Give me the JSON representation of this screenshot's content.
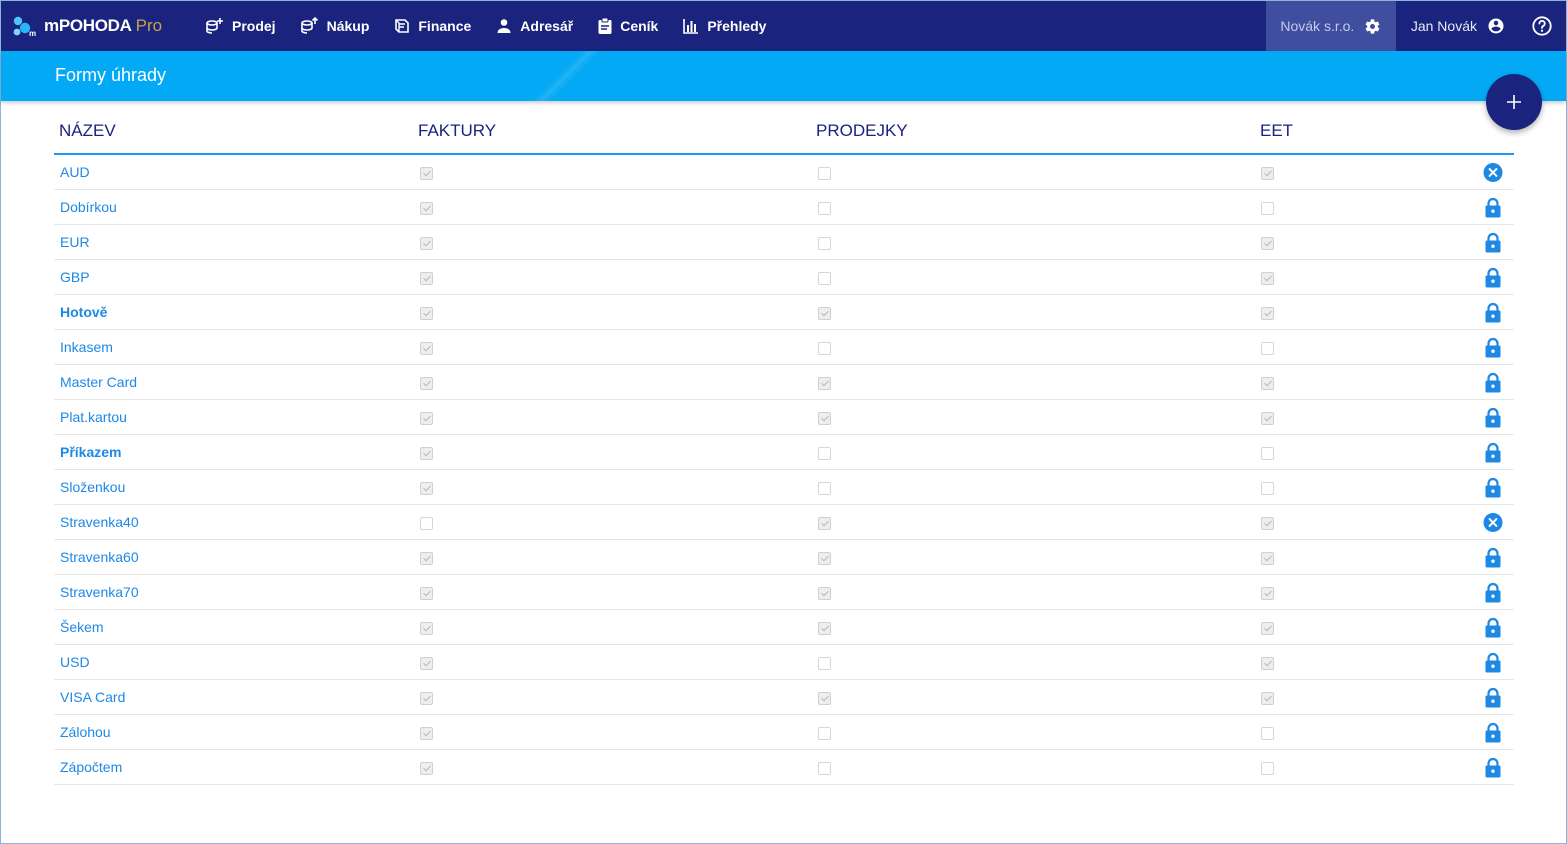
{
  "app": {
    "name": "mPOHODA",
    "edition": "Pro"
  },
  "nav": [
    {
      "label": "Prodej",
      "icon": "sales-icon"
    },
    {
      "label": "Nákup",
      "icon": "purchase-icon"
    },
    {
      "label": "Finance",
      "icon": "finance-icon"
    },
    {
      "label": "Adresář",
      "icon": "person-icon"
    },
    {
      "label": "Ceník",
      "icon": "clipboard-icon"
    },
    {
      "label": "Přehledy",
      "icon": "bar-chart-icon"
    }
  ],
  "company": {
    "label": "Novák s.r.o.",
    "icon": "gear-icon"
  },
  "user": {
    "label": "Jan Novák",
    "icon": "account-circle-icon"
  },
  "help_icon": "help-circle-icon",
  "page": {
    "title": "Formy úhrady"
  },
  "fab_icon": "plus-icon",
  "table": {
    "columns": [
      "NÁZEV",
      "FAKTURY",
      "PRODEJKY",
      "EET"
    ],
    "rows": [
      {
        "name": "AUD",
        "bold": false,
        "faktury": true,
        "prodejky": false,
        "eet": true,
        "action": "delete-icon"
      },
      {
        "name": "Dobírkou",
        "bold": false,
        "faktury": true,
        "prodejky": false,
        "eet": false,
        "action": "lock-icon"
      },
      {
        "name": "EUR",
        "bold": false,
        "faktury": true,
        "prodejky": false,
        "eet": true,
        "action": "lock-icon"
      },
      {
        "name": "GBP",
        "bold": false,
        "faktury": true,
        "prodejky": false,
        "eet": true,
        "action": "lock-icon"
      },
      {
        "name": "Hotově",
        "bold": true,
        "faktury": true,
        "prodejky": true,
        "eet": true,
        "action": "lock-icon"
      },
      {
        "name": "Inkasem",
        "bold": false,
        "faktury": true,
        "prodejky": false,
        "eet": false,
        "action": "lock-icon"
      },
      {
        "name": "Master Card",
        "bold": false,
        "faktury": true,
        "prodejky": true,
        "eet": true,
        "action": "lock-icon"
      },
      {
        "name": "Plat.kartou",
        "bold": false,
        "faktury": true,
        "prodejky": true,
        "eet": true,
        "action": "lock-icon"
      },
      {
        "name": "Příkazem",
        "bold": true,
        "faktury": true,
        "prodejky": false,
        "eet": false,
        "action": "lock-icon"
      },
      {
        "name": "Složenkou",
        "bold": false,
        "faktury": true,
        "prodejky": false,
        "eet": false,
        "action": "lock-icon"
      },
      {
        "name": "Stravenka40",
        "bold": false,
        "faktury": false,
        "prodejky": true,
        "eet": true,
        "action": "delete-icon"
      },
      {
        "name": "Stravenka60",
        "bold": false,
        "faktury": true,
        "prodejky": true,
        "eet": true,
        "action": "lock-icon"
      },
      {
        "name": "Stravenka70",
        "bold": false,
        "faktury": true,
        "prodejky": true,
        "eet": true,
        "action": "lock-icon"
      },
      {
        "name": "Šekem",
        "bold": false,
        "faktury": true,
        "prodejky": true,
        "eet": true,
        "action": "lock-icon"
      },
      {
        "name": "USD",
        "bold": false,
        "faktury": true,
        "prodejky": false,
        "eet": true,
        "action": "lock-icon"
      },
      {
        "name": "VISA Card",
        "bold": false,
        "faktury": true,
        "prodejky": true,
        "eet": true,
        "action": "lock-icon"
      },
      {
        "name": "Zálohou",
        "bold": false,
        "faktury": true,
        "prodejky": false,
        "eet": false,
        "action": "lock-icon"
      },
      {
        "name": "Zápočtem",
        "bold": false,
        "faktury": true,
        "prodejky": false,
        "eet": false,
        "action": "lock-icon"
      }
    ]
  },
  "colors": {
    "navbar": "#1a237e",
    "titlebar": "#03a9f4",
    "link": "#1e88e5",
    "accent": "#2196f3"
  }
}
